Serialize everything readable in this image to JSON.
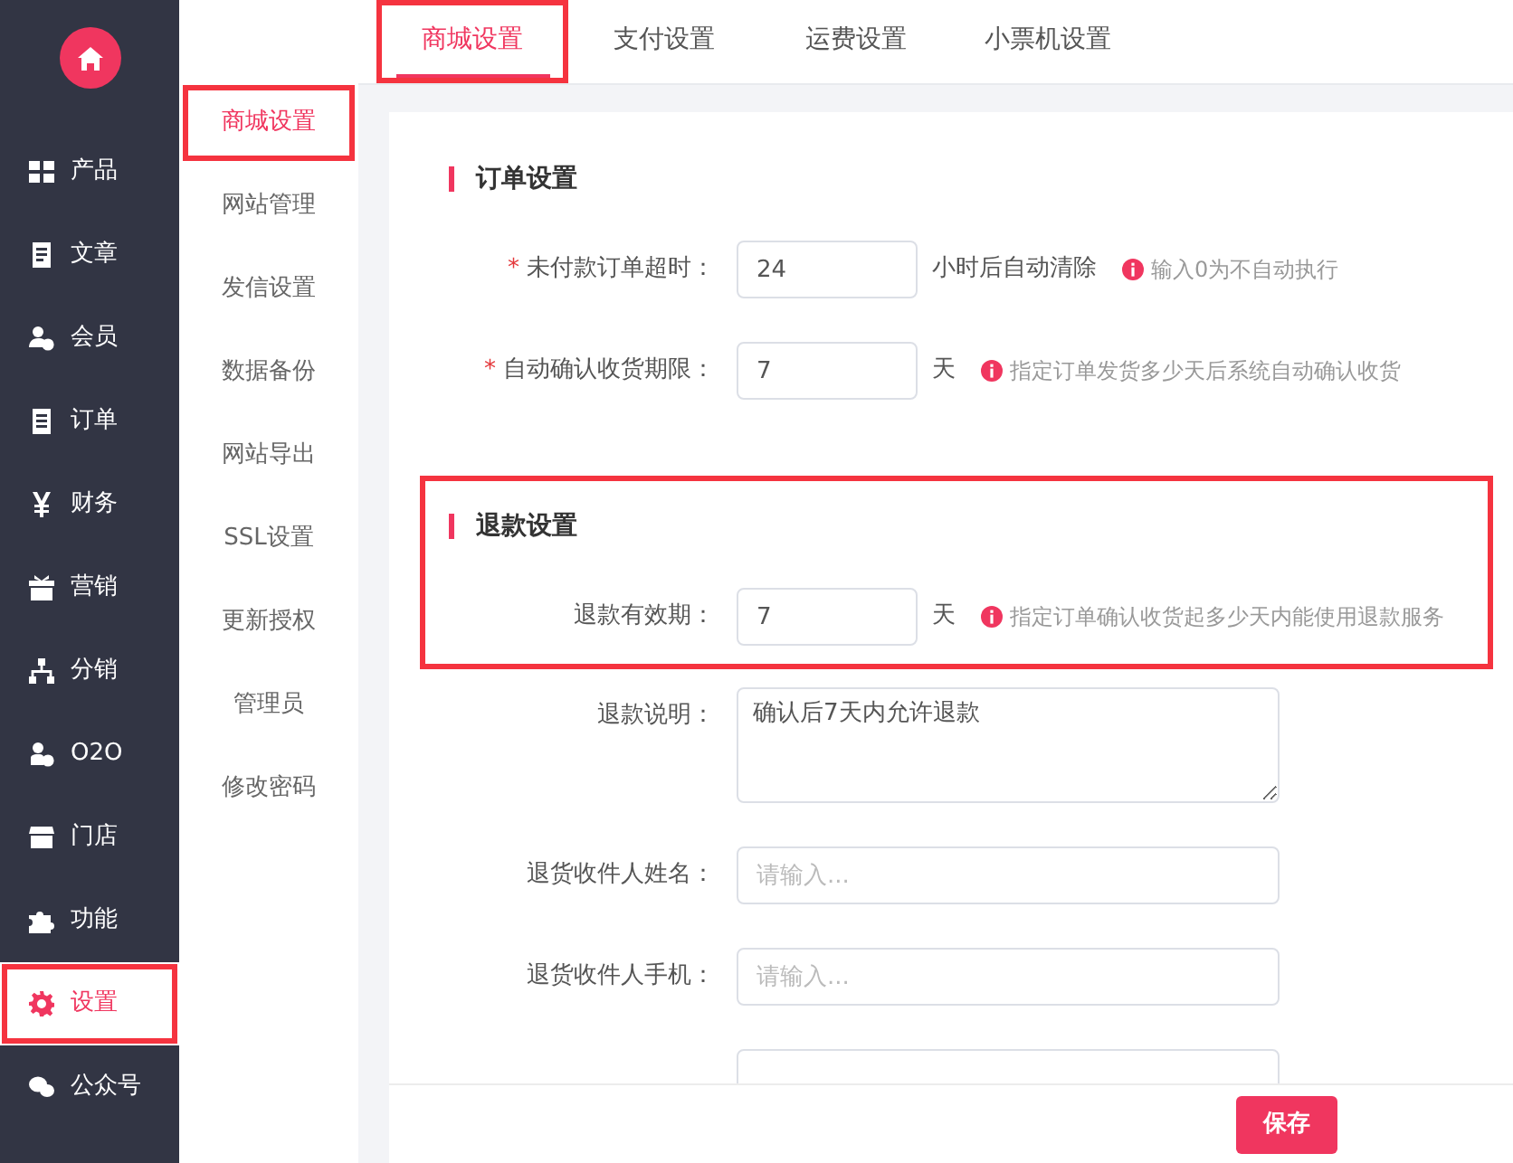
{
  "sidebar": {
    "items": [
      {
        "label": "产品",
        "selected": false,
        "highlighted": false
      },
      {
        "label": "文章",
        "selected": false,
        "highlighted": false
      },
      {
        "label": "会员",
        "selected": false,
        "highlighted": false
      },
      {
        "label": "订单",
        "selected": false,
        "highlighted": false
      },
      {
        "label": "财务",
        "selected": false,
        "highlighted": false
      },
      {
        "label": "营销",
        "selected": false,
        "highlighted": false
      },
      {
        "label": "分销",
        "selected": false,
        "highlighted": false
      },
      {
        "label": "O2O",
        "selected": false,
        "highlighted": false
      },
      {
        "label": "门店",
        "selected": false,
        "highlighted": false
      },
      {
        "label": "功能",
        "selected": false,
        "highlighted": false
      },
      {
        "label": "设置",
        "selected": true,
        "highlighted": true
      },
      {
        "label": "公众号",
        "selected": false,
        "highlighted": false
      }
    ]
  },
  "submenu": {
    "items": [
      {
        "label": "商城设置",
        "selected": true,
        "highlighted": true
      },
      {
        "label": "网站管理",
        "selected": false,
        "highlighted": false
      },
      {
        "label": "发信设置",
        "selected": false,
        "highlighted": false
      },
      {
        "label": "数据备份",
        "selected": false,
        "highlighted": false
      },
      {
        "label": "网站导出",
        "selected": false,
        "highlighted": false
      },
      {
        "label": "SSL设置",
        "selected": false,
        "highlighted": false
      },
      {
        "label": "更新授权",
        "selected": false,
        "highlighted": false
      },
      {
        "label": "管理员",
        "selected": false,
        "highlighted": false
      },
      {
        "label": "修改密码",
        "selected": false,
        "highlighted": false
      }
    ]
  },
  "tabs": [
    {
      "label": "商城设置",
      "selected": true,
      "highlighted": true
    },
    {
      "label": "支付设置",
      "selected": false,
      "highlighted": false
    },
    {
      "label": "运费设置",
      "selected": false,
      "highlighted": false
    },
    {
      "label": "小票机设置",
      "selected": false,
      "highlighted": false
    }
  ],
  "sections": [
    {
      "title": "订单设置",
      "highlighted": false,
      "fields": [
        {
          "kind": "short",
          "label": "未付款订单超时：",
          "required_mark": "*",
          "value": "24",
          "unit": "小时后自动清除",
          "hint": "输入0为不自动执行"
        },
        {
          "kind": "short",
          "label": "自动确认收货期限：",
          "required_mark": "*",
          "value": "7",
          "unit": "天",
          "hint": "指定订单发货多少天后系统自动确认收货"
        }
      ]
    },
    {
      "title": "退款设置",
      "highlighted": true,
      "fields": [
        {
          "kind": "short",
          "label": "退款有效期：",
          "value": "7",
          "unit": "天",
          "hint": "指定订单确认收货起多少天内能使用退款服务"
        }
      ]
    },
    {
      "highlighted": false,
      "fields": [
        {
          "kind": "textarea",
          "label": "退款说明：",
          "value": "确认后7天内允许退款"
        },
        {
          "kind": "long",
          "label": "退货收件人姓名：",
          "placeholder": "请输入..."
        },
        {
          "kind": "long",
          "label": "退货收件人手机：",
          "placeholder": "请输入..."
        },
        {
          "kind": "long"
        }
      ]
    }
  ],
  "footer": {
    "save_button": "保存"
  }
}
